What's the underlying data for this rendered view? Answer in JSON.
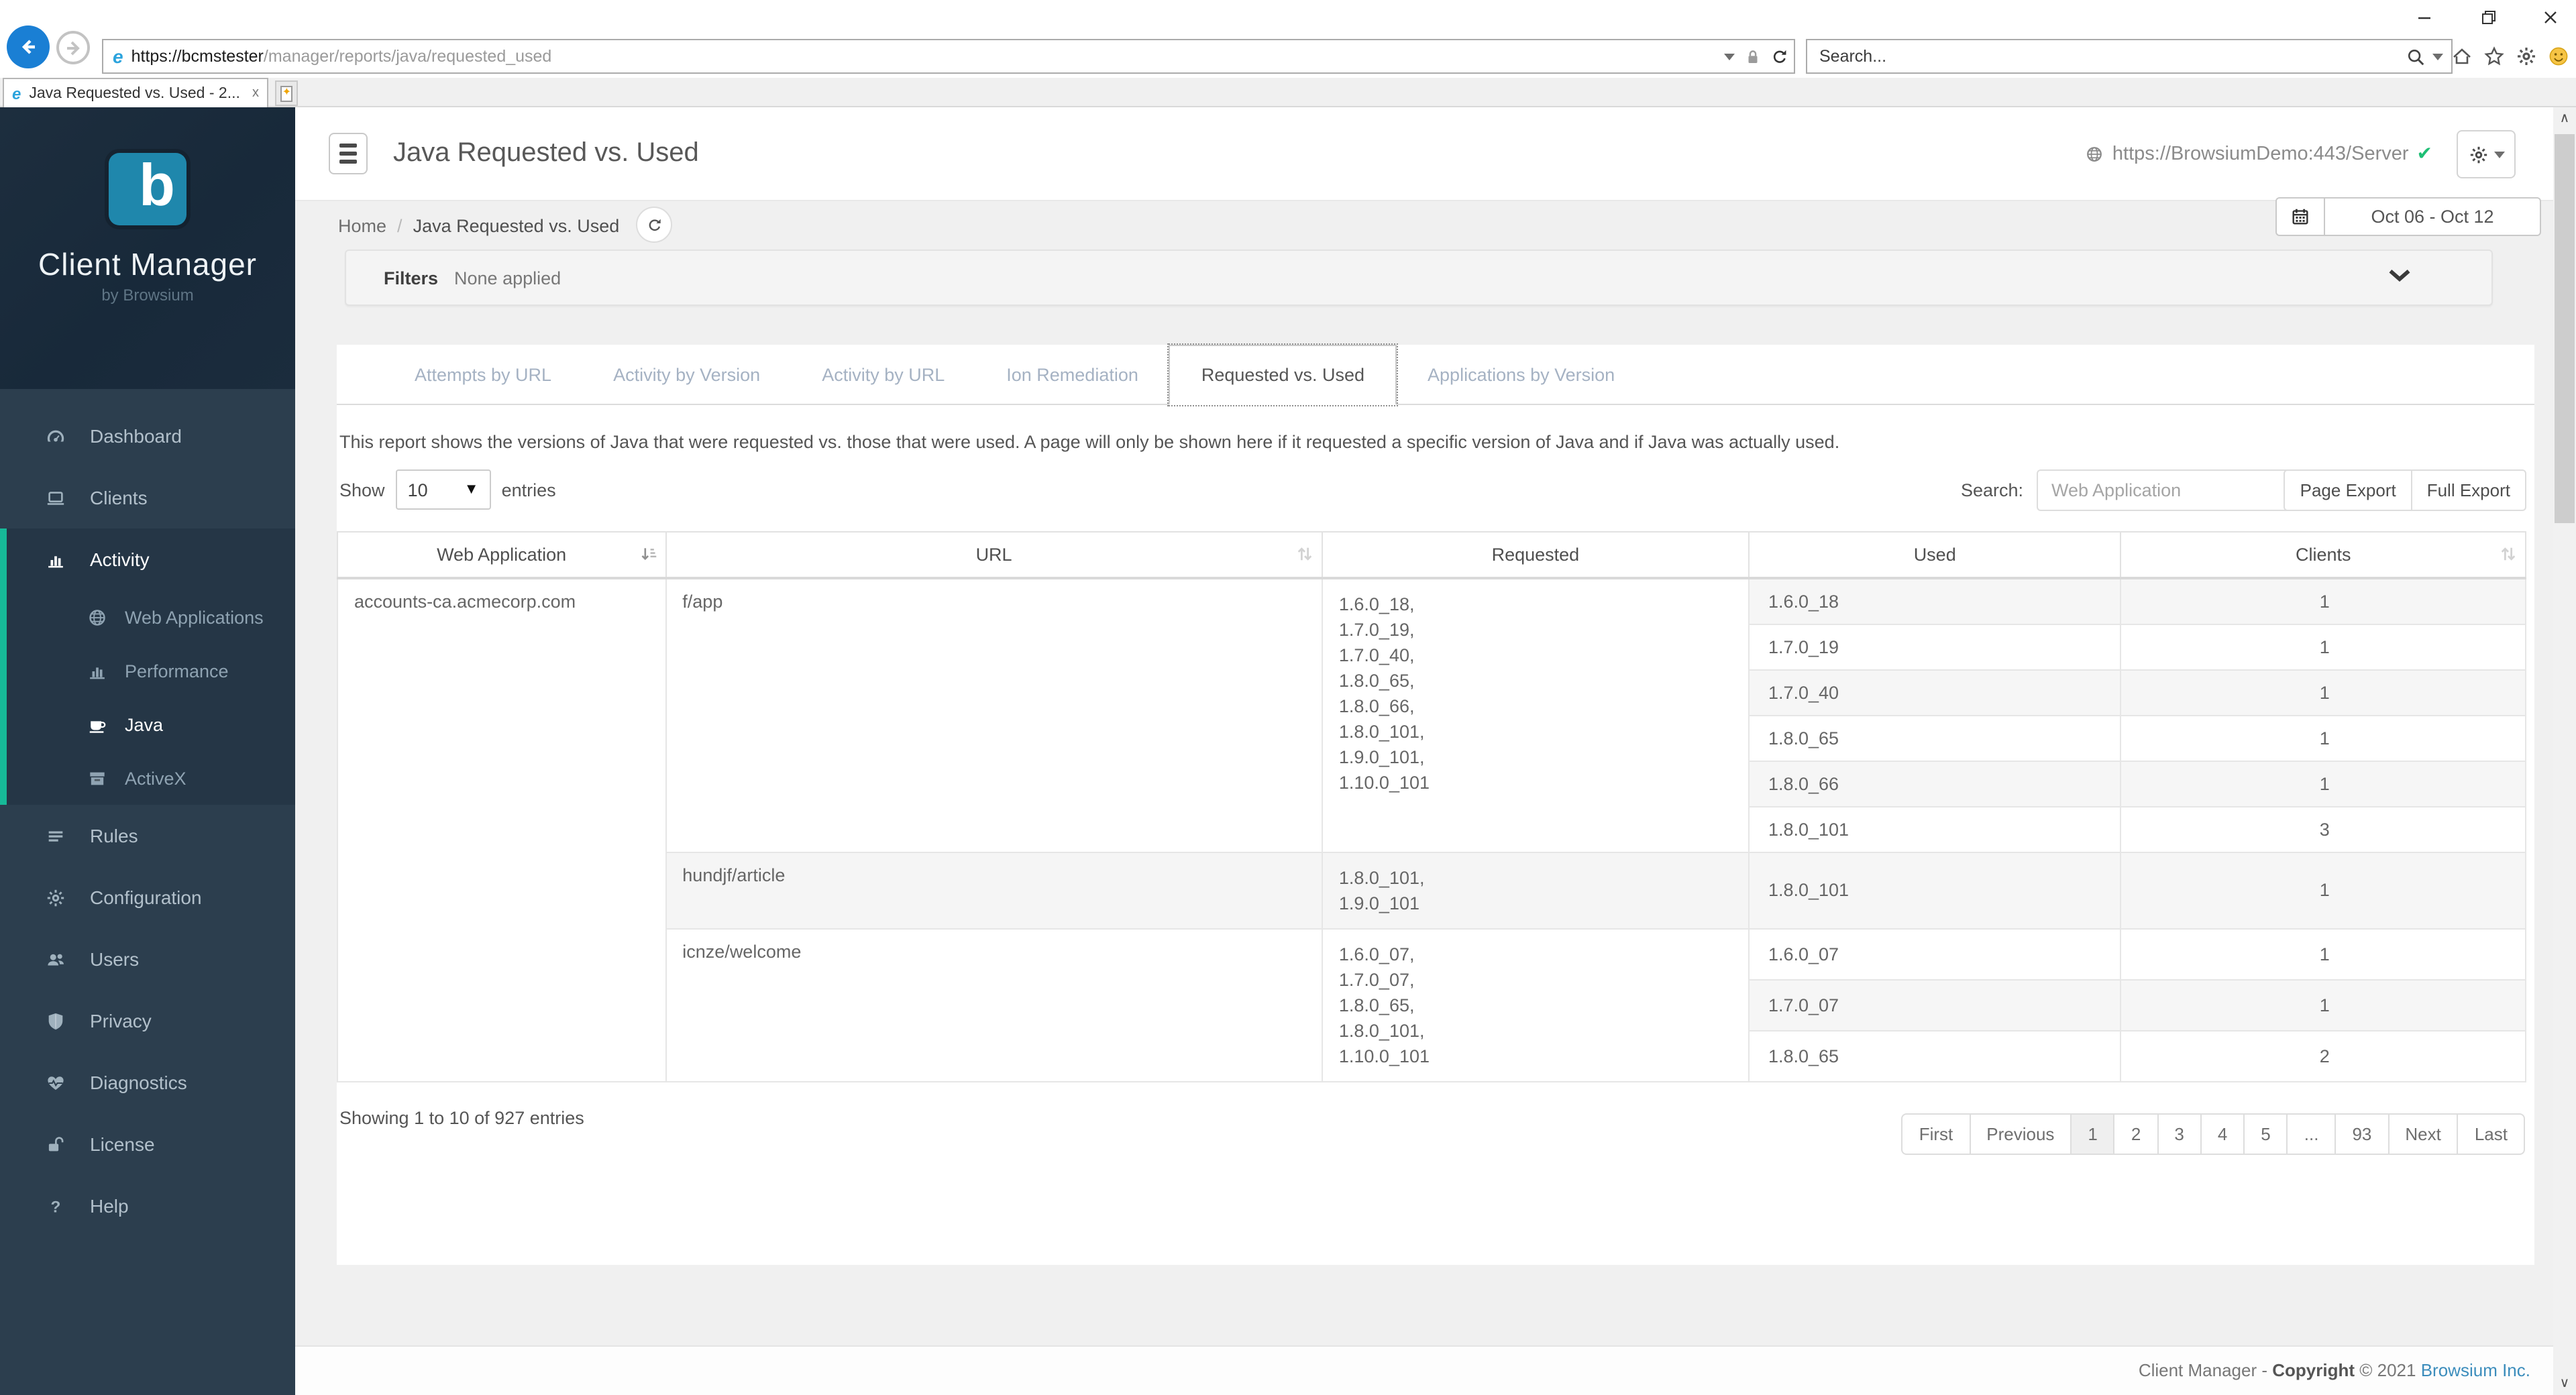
{
  "browser": {
    "url_host": "https://bcmstester",
    "url_path": "/manager/reports/java/requested_used",
    "tab_title": "Java Requested vs. Used - 2...",
    "tab_close": "x",
    "search_placeholder": "Search..."
  },
  "sidebar": {
    "brand_letter": "b",
    "brand_name": "Client Manager",
    "brand_tagline": "by Browsium",
    "items": [
      {
        "label": "Dashboard",
        "icon": "gauge-icon"
      },
      {
        "label": "Clients",
        "icon": "laptop-icon"
      },
      {
        "label": "Activity",
        "icon": "bar-chart-icon",
        "active": true,
        "children": [
          {
            "label": "Web Applications",
            "icon": "globe-icon"
          },
          {
            "label": "Performance",
            "icon": "bar-chart-icon"
          },
          {
            "label": "Java",
            "icon": "coffee-icon",
            "active": true
          },
          {
            "label": "ActiveX",
            "icon": "archive-icon"
          }
        ]
      },
      {
        "label": "Rules",
        "icon": "list-icon"
      },
      {
        "label": "Configuration",
        "icon": "gear-icon"
      },
      {
        "label": "Users",
        "icon": "users-icon"
      },
      {
        "label": "Privacy",
        "icon": "shield-icon"
      },
      {
        "label": "Diagnostics",
        "icon": "heartbeat-icon"
      },
      {
        "label": "License",
        "icon": "unlock-icon"
      },
      {
        "label": "Help",
        "icon": "question-icon"
      }
    ]
  },
  "header": {
    "title": "Java Requested vs. Used",
    "server_url": "https://BrowsiumDemo:443/Server",
    "server_check": "✔"
  },
  "breadcrumb": {
    "home": "Home",
    "sep": "/",
    "current": "Java Requested vs. Used"
  },
  "daterange": "Oct 06 - Oct 12",
  "filters": {
    "label": "Filters",
    "value": "None applied"
  },
  "tabs": {
    "items": [
      "Attempts by URL",
      "Activity by Version",
      "Activity by URL",
      "Ion Remediation",
      "Requested vs. Used",
      "Applications by Version"
    ],
    "active_index": 4
  },
  "report": {
    "description": "This report shows the versions of Java that were requested vs. those that were used. A page will only be shown here if it requested a specific version of Java and if Java was actually used."
  },
  "controls": {
    "show_label": "Show",
    "page_size": "10",
    "entries_label": "entries",
    "search_label": "Search:",
    "search_placeholder": "Web Application",
    "page_export": "Page Export",
    "full_export": "Full Export"
  },
  "table": {
    "columns": [
      {
        "label": "Web Application",
        "sort": "sorted"
      },
      {
        "label": "URL",
        "sort": "both"
      },
      {
        "label": "Requested",
        "sort": "none"
      },
      {
        "label": "Used",
        "sort": "none"
      },
      {
        "label": "Clients",
        "sort": "both"
      }
    ],
    "groups": [
      {
        "web_application": "accounts-ca.acmecorp.com",
        "url_groups": [
          {
            "url": "f/app",
            "requested": [
              "1.6.0_18,",
              "1.7.0_19,",
              "1.7.0_40,",
              "1.8.0_65,",
              "1.8.0_66,",
              "1.8.0_101,",
              "1.9.0_101,",
              "1.10.0_101"
            ],
            "used": [
              {
                "version": "1.6.0_18",
                "clients": "1"
              },
              {
                "version": "1.7.0_19",
                "clients": "1"
              },
              {
                "version": "1.7.0_40",
                "clients": "1"
              },
              {
                "version": "1.8.0_65",
                "clients": "1"
              },
              {
                "version": "1.8.0_66",
                "clients": "1"
              },
              {
                "version": "1.8.0_101",
                "clients": "3"
              }
            ]
          },
          {
            "url": "hundjf/article",
            "requested": [
              "1.8.0_101,",
              "1.9.0_101"
            ],
            "used": [
              {
                "version": "1.8.0_101",
                "clients": "1"
              }
            ]
          },
          {
            "url": "icnze/welcome",
            "requested": [
              "1.6.0_07,",
              "1.7.0_07,",
              "1.8.0_65,",
              "1.8.0_101,",
              "1.10.0_101"
            ],
            "used": [
              {
                "version": "1.6.0_07",
                "clients": "1"
              },
              {
                "version": "1.7.0_07",
                "clients": "1"
              },
              {
                "version": "1.8.0_65",
                "clients": "2"
              }
            ]
          }
        ]
      }
    ]
  },
  "summary": "Showing 1 to 10 of 927 entries",
  "pagination": {
    "items": [
      "First",
      "Previous",
      "1",
      "2",
      "3",
      "4",
      "5",
      "...",
      "93",
      "Next",
      "Last"
    ],
    "active": "1"
  },
  "footer": {
    "prefix": "Client Manager - ",
    "copyright": "Copyright",
    "middle": " © 2021 ",
    "company": "Browsium Inc."
  },
  "colors": {
    "accent_teal": "#17b998",
    "brand_tile": "#1f87ac",
    "link_blue": "#3c8dbc",
    "check_green": "#1fbf75",
    "back_button_blue": "#1a7fd4"
  }
}
